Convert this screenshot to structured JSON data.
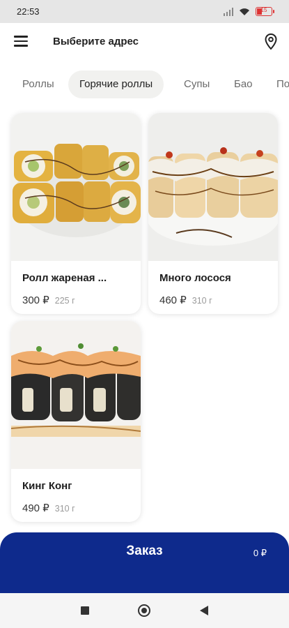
{
  "status": {
    "time": "22:53",
    "battery": "15"
  },
  "header": {
    "address_label": "Выберите адрес"
  },
  "categories": [
    {
      "label": "Роллы",
      "active": false
    },
    {
      "label": "Горячие роллы",
      "active": true
    },
    {
      "label": "Супы",
      "active": false
    },
    {
      "label": "Бао",
      "active": false
    },
    {
      "label": "По",
      "active": false
    }
  ],
  "products": [
    {
      "name": "Ролл жареная ...",
      "price": "300 ₽",
      "weight": "225 г"
    },
    {
      "name": "Много лосося",
      "price": "460 ₽",
      "weight": "310 г"
    },
    {
      "name": "Кинг Конг",
      "price": "490 ₽",
      "weight": "310 г"
    }
  ],
  "order": {
    "label": "Заказ",
    "total": "0 ₽"
  },
  "colors": {
    "accent": "#0e2a8c"
  }
}
